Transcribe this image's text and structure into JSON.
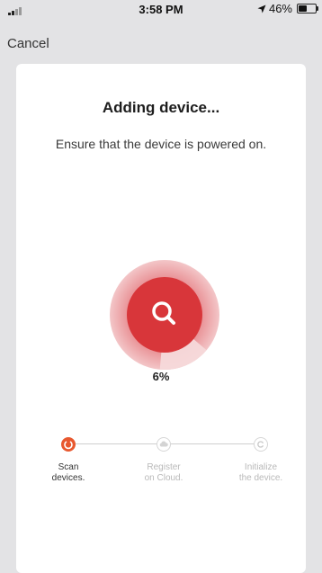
{
  "status_bar": {
    "time": "3:58 PM",
    "battery": "46%",
    "battery_level": 0.46
  },
  "nav": {
    "cancel_label": "Cancel"
  },
  "dialog": {
    "title": "Adding device...",
    "subtitle": "Ensure that the device is powered on.",
    "progress": 6,
    "progress_label": "6%"
  },
  "steps": [
    {
      "line1": "Scan",
      "line2": "devices.",
      "state": "active"
    },
    {
      "line1": "Register",
      "line2": "on Cloud.",
      "state": "pending"
    },
    {
      "line1": "Initialize",
      "line2": "the device.",
      "state": "pending"
    }
  ],
  "colors": {
    "accent": "#e8582f",
    "ring_outer": "#f1b4b7",
    "ring_inner": "#d8363a"
  },
  "icons": {
    "scan_step": "spinner-icon",
    "register_step": "cloud-icon",
    "initialize_step": "initialize-icon",
    "center": "search-icon"
  }
}
